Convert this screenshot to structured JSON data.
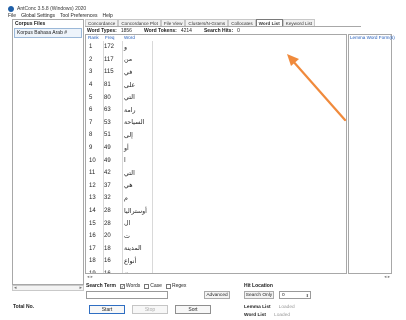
{
  "window": {
    "title": "AntConc 3.5.8 (Windows) 2020"
  },
  "menu": [
    "File",
    "Global Settings",
    "Tool Preferences",
    "Help"
  ],
  "corpus": {
    "header": "Corpus Files",
    "files": [
      "Korpus Bahasa Arab #"
    ]
  },
  "tabs": [
    {
      "label": "Concordance",
      "active": false
    },
    {
      "label": "Concordance Plot",
      "active": false
    },
    {
      "label": "File View",
      "active": false
    },
    {
      "label": "Clusters/N-Grams",
      "active": false
    },
    {
      "label": "Collocates",
      "active": false
    },
    {
      "label": "Word List",
      "active": true
    },
    {
      "label": "Keyword List",
      "active": false
    }
  ],
  "stats": {
    "types_label": "Word Types:",
    "types": "1856",
    "tokens_label": "Word Tokens:",
    "tokens": "4214",
    "hits_label": "Search Hits:",
    "hits": "0"
  },
  "columns": {
    "rank": "Rank",
    "freq": "Freq",
    "word": "Word",
    "lemma": "Lemma Word Form(s)"
  },
  "rows": [
    {
      "rank": "1",
      "freq": "172",
      "word": "و"
    },
    {
      "rank": "2",
      "freq": "117",
      "word": "من"
    },
    {
      "rank": "3",
      "freq": "115",
      "word": "في"
    },
    {
      "rank": "4",
      "freq": "81",
      "word": "على"
    },
    {
      "rank": "5",
      "freq": "80",
      "word": "التي"
    },
    {
      "rank": "6",
      "freq": "63",
      "word": "رامة"
    },
    {
      "rank": "7",
      "freq": "53",
      "word": "السياحة"
    },
    {
      "rank": "8",
      "freq": "51",
      "word": "إلى"
    },
    {
      "rank": "9",
      "freq": "49",
      "word": "أو"
    },
    {
      "rank": "10",
      "freq": "49",
      "word": "ا"
    },
    {
      "rank": "11",
      "freq": "42",
      "word": "التي"
    },
    {
      "rank": "12",
      "freq": "37",
      "word": "هي"
    },
    {
      "rank": "13",
      "freq": "32",
      "word": "م"
    },
    {
      "rank": "14",
      "freq": "28",
      "word": "أوستراليا"
    },
    {
      "rank": "15",
      "freq": "28",
      "word": "ال"
    },
    {
      "rank": "16",
      "freq": "20",
      "word": "ت"
    },
    {
      "rank": "17",
      "freq": "18",
      "word": "المدينة"
    },
    {
      "rank": "18",
      "freq": "16",
      "word": "أنواع"
    },
    {
      "rank": "19",
      "freq": "16",
      "word": "ن"
    }
  ],
  "search": {
    "label": "Search Term",
    "words_label": "Words",
    "words_checked": true,
    "case_label": "Case",
    "regex_label": "Regex",
    "advanced_label": "Advanced",
    "hit_location_label": "Hit Location",
    "search_only_label": "Search Only",
    "hit_value": "0"
  },
  "buttons": {
    "start": "Start",
    "stop": "Stop",
    "sort": "Sort"
  },
  "lemma": {
    "list_label": "Lemma List",
    "list_status": "Loaded",
    "word_list_label": "Word List",
    "word_list_status": "Loaded"
  },
  "footer": {
    "total_label": "Total No."
  },
  "colors": {
    "accent": "#1d58b8",
    "arrow": "#f08a3c"
  }
}
